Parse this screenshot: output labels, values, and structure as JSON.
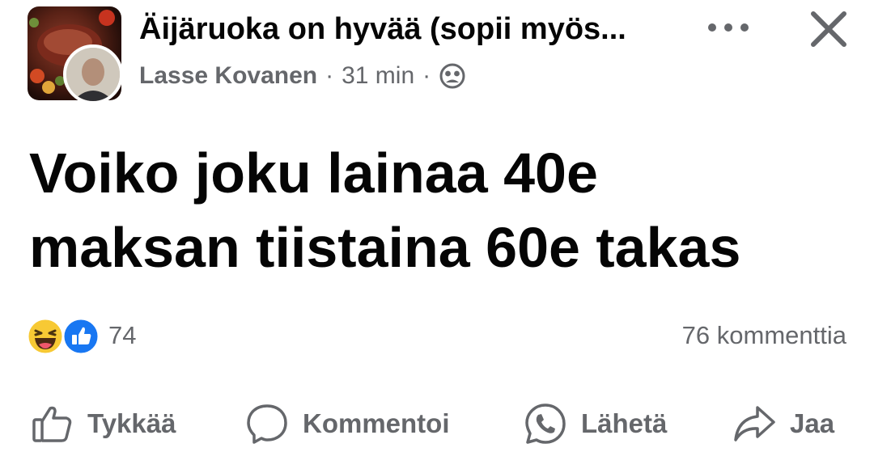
{
  "header": {
    "group_name": "Äijäruoka on hyvää (sopii myös...",
    "author": "Lasse Kovanen",
    "separator": "·",
    "time": "31 min",
    "audience_icon": "group-audience-icon",
    "more_icon": "more-horizontal-icon",
    "close_icon": "close-icon"
  },
  "post": {
    "line1": "Voiko joku lainaa 40e",
    "line2": "maksan tiistaina 60e takas"
  },
  "stats": {
    "reaction_icons": [
      "haha-icon",
      "like-icon"
    ],
    "reaction_count": "74",
    "comment_count": "76 kommenttia"
  },
  "actions": {
    "like": "Tykkää",
    "comment": "Kommentoi",
    "send": "Lähetä",
    "share": "Jaa"
  },
  "colors": {
    "text_primary": "#050505",
    "text_secondary": "#65676b",
    "like_blue": "#1877f2",
    "haha_yellow": "#f7c934"
  }
}
